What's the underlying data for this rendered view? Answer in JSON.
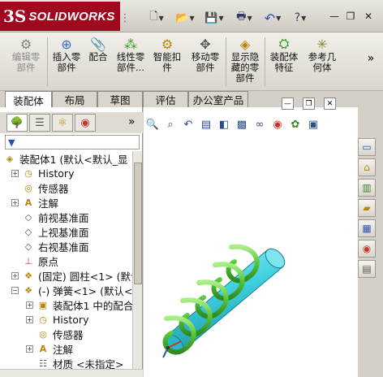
{
  "app": {
    "logo_mark": "3S",
    "logo_text": "SOLIDWORKS"
  },
  "quick_access": {
    "new": "🗋",
    "open": "📂",
    "save": "💾",
    "print": "🖶",
    "undo": "↶",
    "help": "?"
  },
  "window_controls": {
    "minimize": "—",
    "restore": "❐",
    "close": "✕"
  },
  "ribbon": {
    "buttons": [
      {
        "label": "编辑零\n部件",
        "icon": "edit-component-icon",
        "enabled": false
      },
      {
        "label": "插入零\n部件",
        "icon": "insert-component-icon",
        "enabled": true
      },
      {
        "label": "配合",
        "icon": "mate-icon",
        "enabled": true
      },
      {
        "label": "线性零\n部件...",
        "icon": "linear-pattern-icon",
        "enabled": true
      },
      {
        "label": "智能扣\n件",
        "icon": "smart-fastener-icon",
        "enabled": true
      },
      {
        "label": "移动零\n部件",
        "icon": "move-component-icon",
        "enabled": true
      },
      {
        "label": "显示隐\n藏的零\n部件",
        "icon": "show-hidden-icon",
        "enabled": true
      },
      {
        "label": "装配体\n特征",
        "icon": "assembly-feature-icon",
        "enabled": true
      },
      {
        "label": "参考几\n何体",
        "icon": "reference-geometry-icon",
        "enabled": true
      }
    ],
    "more": "»"
  },
  "tabs": [
    {
      "label": "装配体",
      "active": true
    },
    {
      "label": "布局",
      "active": false
    },
    {
      "label": "草图",
      "active": false
    },
    {
      "label": "评估",
      "active": false
    },
    {
      "label": "办公室产品",
      "active": false
    }
  ],
  "panel": {
    "more": "»",
    "filter_icon": "▼"
  },
  "tree": [
    {
      "label": "装配体1  (默认<默认_显",
      "depth": 0,
      "expander": "none",
      "icon": "assembly-icon"
    },
    {
      "label": "History",
      "depth": 1,
      "expander": "+",
      "icon": "history-icon"
    },
    {
      "label": "传感器",
      "depth": 1,
      "expander": "none",
      "icon": "sensor-icon"
    },
    {
      "label": "注解",
      "depth": 1,
      "expander": "+",
      "icon": "annotation-icon"
    },
    {
      "label": "前视基准面",
      "depth": 1,
      "expander": "none",
      "icon": "plane-icon"
    },
    {
      "label": "上视基准面",
      "depth": 1,
      "expander": "none",
      "icon": "plane-icon"
    },
    {
      "label": "右视基准面",
      "depth": 1,
      "expander": "none",
      "icon": "plane-icon"
    },
    {
      "label": "原点",
      "depth": 1,
      "expander": "none",
      "icon": "origin-icon"
    },
    {
      "label": "(固定) 圆柱<1> (默认",
      "depth": 1,
      "expander": "+",
      "icon": "part-icon"
    },
    {
      "label": "(-) 弹簧<1> (默认<<",
      "depth": 1,
      "expander": "-",
      "icon": "part-icon"
    },
    {
      "label": "装配体1 中的配合",
      "depth": 2,
      "expander": "+",
      "icon": "mates-folder-icon"
    },
    {
      "label": "History",
      "depth": 2,
      "expander": "+",
      "icon": "history-icon"
    },
    {
      "label": "传感器",
      "depth": 2,
      "expander": "none",
      "icon": "sensor-icon"
    },
    {
      "label": "注解",
      "depth": 2,
      "expander": "+",
      "icon": "annotation-icon"
    },
    {
      "label": "材质 <未指定>",
      "depth": 2,
      "expander": "none",
      "icon": "material-icon"
    }
  ]
}
